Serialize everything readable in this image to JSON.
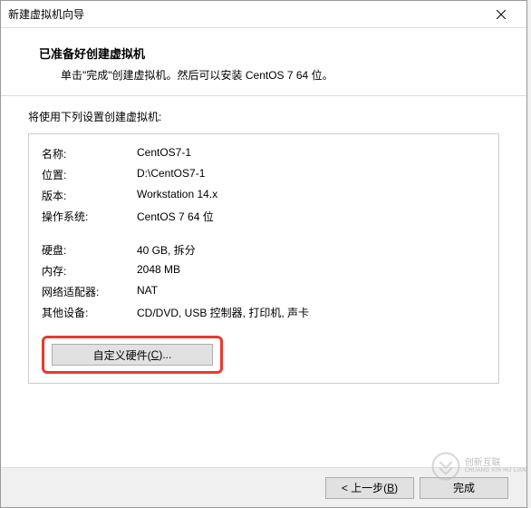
{
  "window": {
    "title": "新建虚拟机向导"
  },
  "header": {
    "title": "已准备好创建虚拟机",
    "subtitle": "单击\"完成\"创建虚拟机。然后可以安装 CentOS 7 64 位。"
  },
  "content": {
    "intro": "将使用下列设置创建虚拟机:",
    "rows": [
      {
        "label": "名称:",
        "value": "CentOS7-1"
      },
      {
        "label": "位置:",
        "value": "D:\\CentOS7-1"
      },
      {
        "label": "版本:",
        "value": "Workstation 14.x"
      },
      {
        "label": "操作系统:",
        "value": "CentOS 7 64 位"
      }
    ],
    "rows2": [
      {
        "label": "硬盘:",
        "value": "40 GB, 拆分"
      },
      {
        "label": "内存:",
        "value": "2048 MB"
      },
      {
        "label": "网络适配器:",
        "value": "NAT"
      },
      {
        "label": "其他设备:",
        "value": "CD/DVD, USB 控制器, 打印机, 声卡"
      }
    ],
    "customize_prefix": "自定义硬件(",
    "customize_key": "C",
    "customize_suffix": ")..."
  },
  "footer": {
    "back_prefix": "< 上一步(",
    "back_key": "B",
    "back_suffix": ")",
    "finish": "完成"
  },
  "watermark": {
    "brand_cn": "创新互联",
    "brand_en": "CHUANG XIN HU LIAN"
  }
}
